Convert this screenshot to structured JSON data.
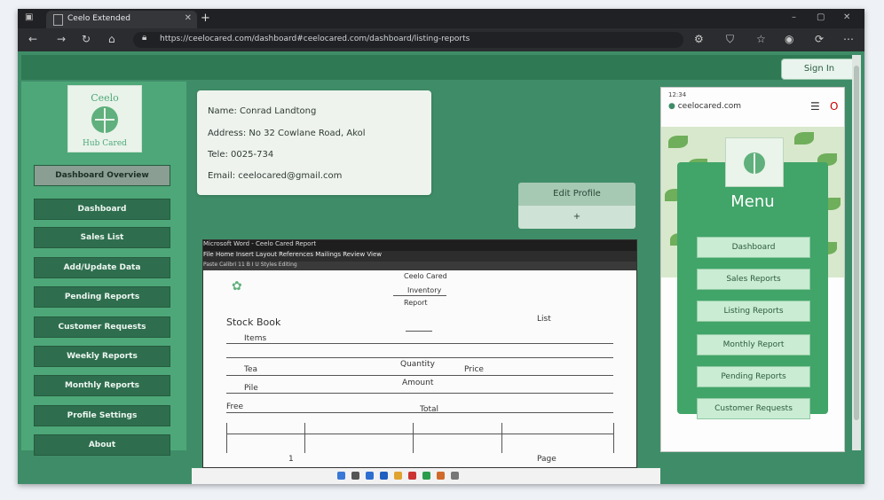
{
  "browser": {
    "tab_title": "Ceelo Extended",
    "url": "https://ceelocared.com/dashboard#ceelocared.com/dashboard/listing-reports"
  },
  "header": {
    "signin_label": "Sign In"
  },
  "sidebar": {
    "logo_text": [
      "Ceelo",
      "Hub Cared"
    ],
    "items": [
      {
        "label": "Dashboard Overview",
        "active": true
      },
      {
        "label": "Dashboard"
      },
      {
        "label": "Sales List"
      },
      {
        "label": "Add/Update Data"
      },
      {
        "label": "Pending Reports"
      },
      {
        "label": "Customer Requests"
      },
      {
        "label": "Weekly Reports"
      },
      {
        "label": "Monthly Reports"
      },
      {
        "label": "Profile Settings"
      },
      {
        "label": "About"
      }
    ]
  },
  "info": {
    "rows": [
      {
        "key": "Name",
        "value": "Name: Conrad Landtong"
      },
      {
        "key": "Address",
        "value": "Address: No 32 Cowlane Road, Akol"
      },
      {
        "key": "Tele",
        "value": "Tele: 0025-734"
      },
      {
        "key": "Email",
        "value": "Email: ceelocared@gmail.com"
      }
    ]
  },
  "actions": {
    "primary_label": "Edit Profile",
    "secondary_label": "+"
  },
  "preview": {
    "title_bar": "Microsoft Word - Ceelo Cared Report",
    "ribbon": "File Home Insert Layout References Mailings Review View",
    "subribbon": "Paste  Calibri  11  B I U  Styles  Editing",
    "doc_heading": [
      "Ceelo Cared",
      "Inventory",
      "Report"
    ],
    "left_label": "Stock Book",
    "right_label": "List",
    "row_labels": [
      "Items",
      "Tea",
      "Pile",
      "Free"
    ],
    "mid_values": [
      "Quantity",
      "Price",
      "Amount",
      "Total"
    ],
    "footer_left": "1",
    "footer_right": "Page"
  },
  "phone": {
    "status": "12:34",
    "url": "ceelocared.com",
    "menu_title": "Menu",
    "menu_items": [
      "Dashboard",
      "Sales Reports",
      "Listing Reports",
      "Monthly Report",
      "Pending Reports",
      "Customer Requests"
    ]
  },
  "colors": {
    "window_green": "#3f8d68",
    "sidebar_green": "#4ea778",
    "nav_dark": "#2e6e4e",
    "menu_green": "#41a468"
  }
}
